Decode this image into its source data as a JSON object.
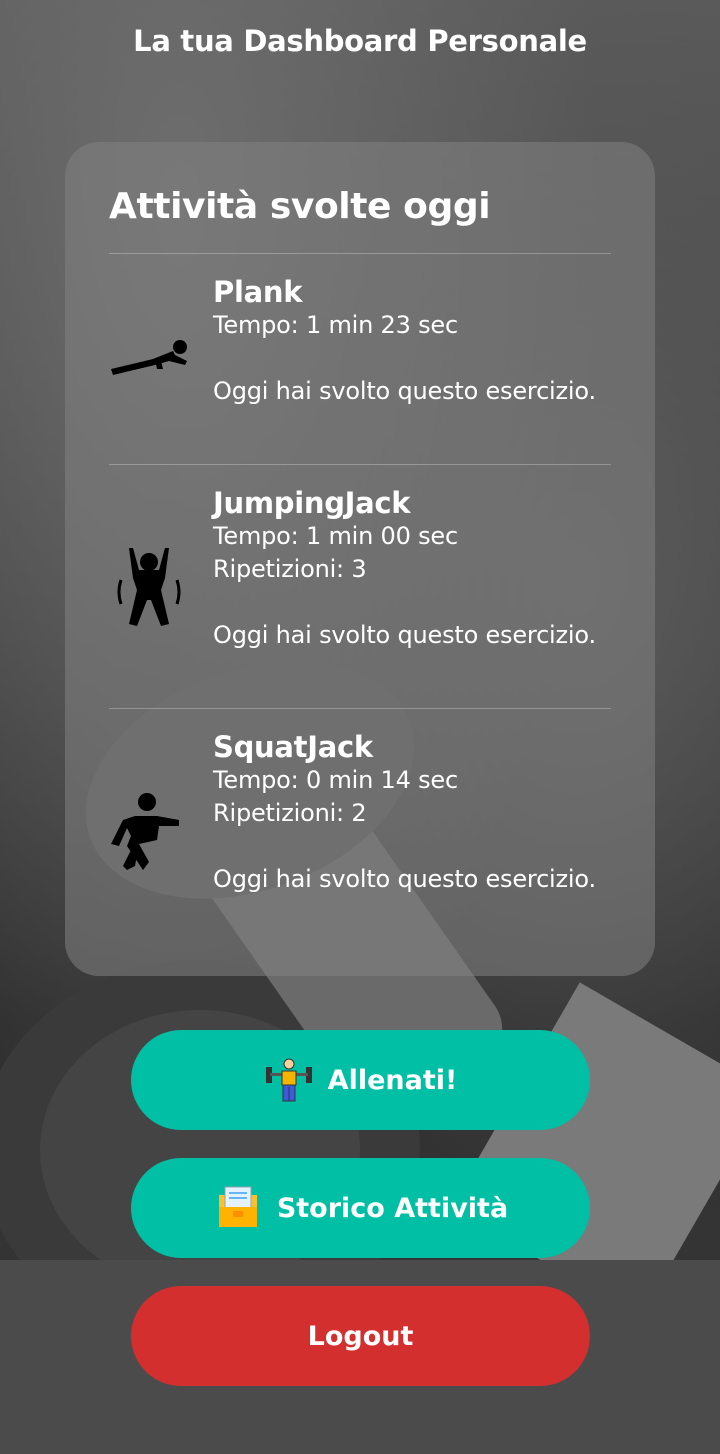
{
  "header": {
    "title": "La tua Dashboard Personale"
  },
  "activities": {
    "heading": "Attività svolte oggi",
    "items": [
      {
        "name": "Plank",
        "time": "Tempo: 1 min 23 sec",
        "reps": "",
        "note": "Oggi hai svolto questo esercizio.",
        "icon": "plank-icon"
      },
      {
        "name": "JumpingJack",
        "time": "Tempo: 1 min 00 sec",
        "reps": "Ripetizioni: 3",
        "note": "Oggi hai svolto questo esercizio.",
        "icon": "jumping-jack-icon"
      },
      {
        "name": "SquatJack",
        "time": "Tempo: 0 min 14 sec",
        "reps": "Ripetizioni: 2",
        "note": "Oggi hai svolto questo esercizio.",
        "icon": "squat-icon"
      }
    ]
  },
  "buttons": {
    "train": {
      "label": "Allenati!",
      "icon": "weightlifter-icon"
    },
    "history": {
      "label": "Storico Attività",
      "icon": "file-folder-icon"
    },
    "logout": {
      "label": "Logout"
    }
  },
  "colors": {
    "teal": "#00bfa5",
    "red": "#d32f2f"
  }
}
